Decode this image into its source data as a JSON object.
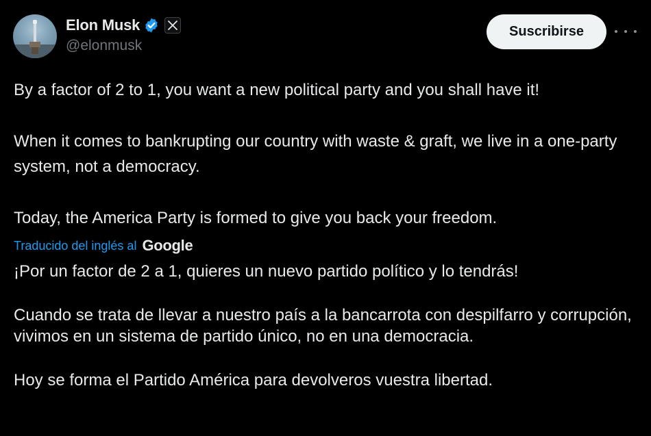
{
  "author": {
    "display_name": "Elon Musk",
    "handle": "@elonmusk",
    "verified_icon": "verified-badge-icon",
    "affiliate_icon": "x-logo-icon"
  },
  "actions": {
    "subscribe_label": "Suscribirse",
    "more_icon": "more-horizontal-icon"
  },
  "tweet": {
    "paragraphs": [
      "By a factor of 2 to 1, you want a new political party and you shall have it!",
      "When it comes to bankrupting our country with waste & graft, we live in a one-party system, not a democracy.",
      "Today, the America Party is formed to give you back your freedom."
    ]
  },
  "translation": {
    "credit_label": "Traducido del inglés al",
    "provider": "Google",
    "paragraphs": [
      "¡Por un factor de 2 a 1, quieres un nuevo partido político y lo tendrás!",
      "Cuando se trata de llevar a nuestro país a la bancarrota con despilfarro y corrupción, vivimos en un sistema de partido único, no en una democracia.",
      "Hoy se forma el Partido América para devolveros vuestra libertad."
    ]
  },
  "colors": {
    "background": "#000000",
    "text": "#e7e9ea",
    "secondary_text": "#71767b",
    "accent_blue": "#1d9bf0",
    "button_bg": "#eff3f4"
  }
}
